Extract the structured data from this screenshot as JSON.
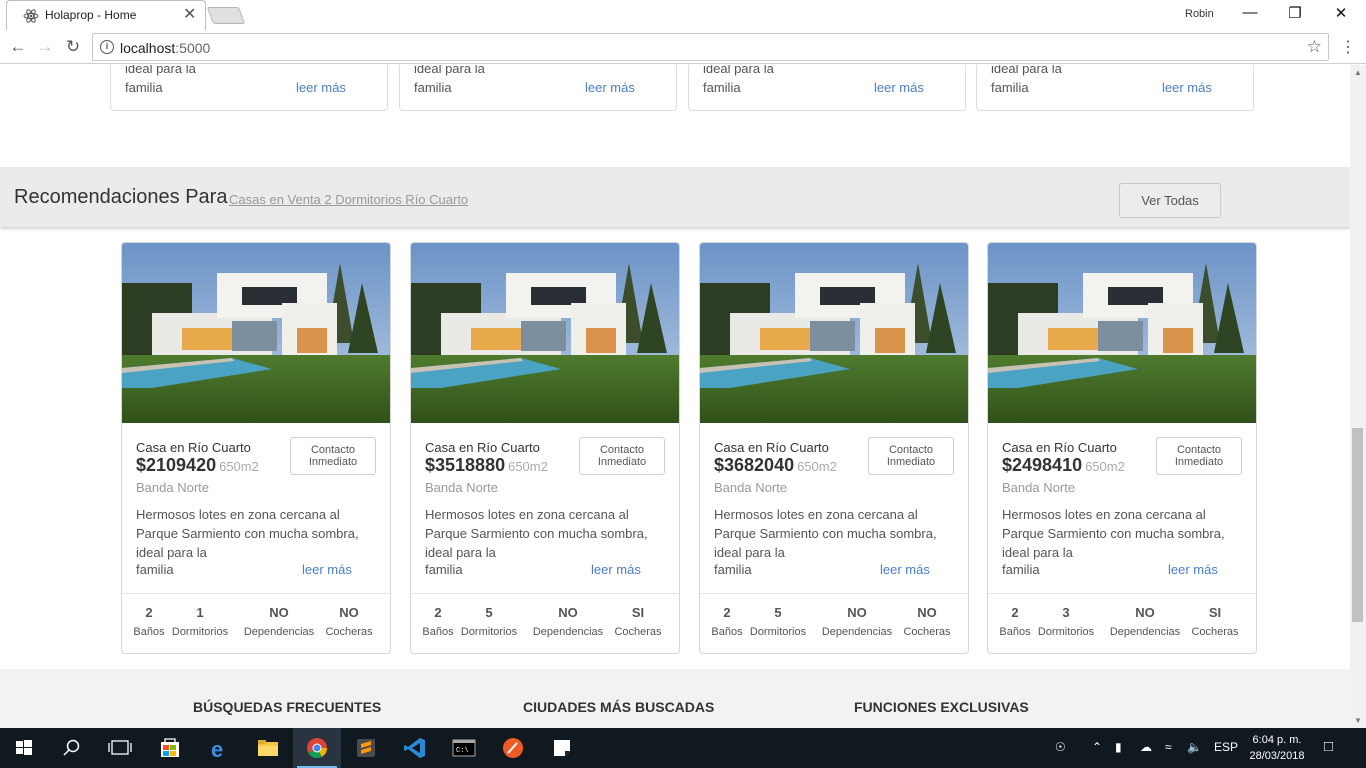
{
  "browser": {
    "tab_title": "Holaprop - Home",
    "tab_close": "✕",
    "user": "Robin",
    "url_host": "localhost",
    "url_port": ":5000",
    "minimize": "—",
    "maximize": "❐",
    "close": "✕"
  },
  "top_cards": [
    {
      "desc_line1": "ideal para la",
      "desc_line2": "familia",
      "more": "leer más"
    },
    {
      "desc_line1": "ideal para la",
      "desc_line2": "familia",
      "more": "leer más"
    },
    {
      "desc_line1": "ideal para la",
      "desc_line2": "familia",
      "more": "leer más"
    },
    {
      "desc_line1": "ideal para la",
      "desc_line2": "familia",
      "more": "leer más"
    }
  ],
  "recommendations": {
    "title": "Recomendaciones Para",
    "subtitle": "Casas en Venta 2 Dormitorios Río Cuarto",
    "button": "Ver Todas"
  },
  "properties": [
    {
      "type": "Casa en Río Cuarto",
      "price": "$2109420",
      "area": "650m2",
      "zone": "Banda Norte",
      "contact": "Contacto Inmediato",
      "desc": "Hermosos lotes en zona cercana al Parque Sarmiento con mucha sombra, ideal para la",
      "last": "familia",
      "more": "leer más",
      "features": {
        "banos": "2",
        "dormitorios": "1",
        "dependencias": "NO",
        "cocheras": "NO"
      }
    },
    {
      "type": "Casa en Río Cuarto",
      "price": "$3518880",
      "area": "650m2",
      "zone": "Banda Norte",
      "contact": "Contacto Inmediato",
      "desc": "Hermosos lotes en zona cercana al Parque Sarmiento con mucha sombra, ideal para la",
      "last": "familia",
      "more": "leer más",
      "features": {
        "banos": "2",
        "dormitorios": "5",
        "dependencias": "NO",
        "cocheras": "SI"
      }
    },
    {
      "type": "Casa en Río Cuarto",
      "price": "$3682040",
      "area": "650m2",
      "zone": "Banda Norte",
      "contact": "Contacto Inmediato",
      "desc": "Hermosos lotes en zona cercana al Parque Sarmiento con mucha sombra, ideal para la",
      "last": "familia",
      "more": "leer más",
      "features": {
        "banos": "2",
        "dormitorios": "5",
        "dependencias": "NO",
        "cocheras": "NO"
      }
    },
    {
      "type": "Casa en Río Cuarto",
      "price": "$2498410",
      "area": "650m2",
      "zone": "Banda Norte",
      "contact": "Contacto Inmediato",
      "desc": "Hermosos lotes en zona cercana al Parque Sarmiento con mucha sombra, ideal para la",
      "last": "familia",
      "more": "leer más",
      "features": {
        "banos": "2",
        "dormitorios": "3",
        "dependencias": "NO",
        "cocheras": "SI"
      }
    }
  ],
  "feature_labels": {
    "banos": "Baños",
    "dormitorios": "Dormitorios",
    "dependencias": "Dependencias",
    "cocheras": "Cocheras"
  },
  "footer": {
    "col1": "BÚSQUEDAS FRECUENTES",
    "col2": "CIUDADES MÁS BUSCADAS",
    "col3": "FUNCIONES EXCLUSIVAS"
  },
  "taskbar": {
    "language": "ESP",
    "time": "6:04 p. m.",
    "date": "28/03/2018"
  },
  "colors": {
    "link": "#4a7fc1",
    "taskbar": "#101820",
    "banner": "#ebebeb"
  }
}
